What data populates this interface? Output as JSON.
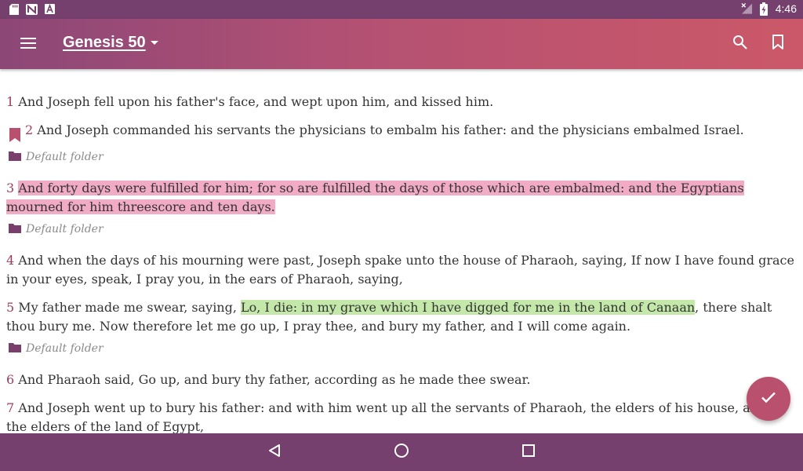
{
  "status_bar": {
    "time": "4:46",
    "icons": [
      "sd-card-icon",
      "n-notification-icon",
      "a-notification-icon",
      "no-signal-icon",
      "battery-charging-icon"
    ]
  },
  "app_bar": {
    "title": "Genesis 50",
    "icons": [
      "menu-icon",
      "dropdown-arrow-icon",
      "search-icon",
      "bookmark-icon"
    ]
  },
  "verses": [
    {
      "number": "1",
      "text": "And Joseph fell upon his father's face, and wept upon him, and kissed him."
    },
    {
      "number": "2",
      "text": "And Joseph commanded his servants the physicians to embalm his father: and the physicians embalmed Israel.",
      "bookmarked": true,
      "folder": "Default folder"
    },
    {
      "number": "3",
      "text": "And forty days were fulfilled for him; for so are fulfilled the days of those which are embalmed: and the Egyptians mourned for him threescore and ten days.",
      "highlight": "pink",
      "folder": "Default folder"
    },
    {
      "number": "4",
      "text": "And when the days of his mourning were past, Joseph spake unto the house of Pharaoh, saying, If now I have found grace in your eyes, speak, I pray you, in the ears of Pharaoh, saying,"
    },
    {
      "number": "5",
      "text_before": "My father made me swear, saying, ",
      "text_highlight": "Lo, I die: in my grave which I have digged for me in the land of Canaan",
      "text_after": ", there shalt thou bury me. Now therefore let me go up, I pray thee, and bury my father, and I will come again.",
      "highlight": "green",
      "folder": "Default folder"
    },
    {
      "number": "6",
      "text": "And Pharaoh said, Go up, and bury thy father, according as he made thee swear."
    },
    {
      "number": "7",
      "text": "And Joseph went up to bury his father: and with him went up all the servants of Pharaoh, the elders of his house, and all the elders of the land of Egypt,"
    }
  ],
  "fab": {
    "icon": "check-icon"
  },
  "nav_bar": {
    "icons": [
      "back-icon",
      "home-icon",
      "recents-icon"
    ]
  },
  "colors": {
    "status_bar": "#753f6e",
    "app_bar_start": "#8c4777",
    "app_bar_end": "#cb5868",
    "verse_number": "#a33a5b",
    "highlight_pink": "#e978a0",
    "highlight_green": "#afe08c",
    "fab": "#b9506d",
    "folder_icon": "#7a3e6c"
  }
}
